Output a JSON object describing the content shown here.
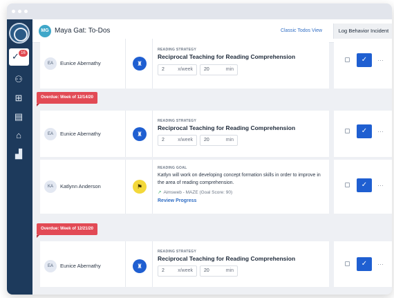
{
  "header": {
    "user_initials": "MG",
    "title": "Maya Gat: To-Dos",
    "classic_link": "Classic Todos View",
    "log_button": "Log Behavior Incident"
  },
  "sidebar": {
    "badge": "16",
    "items": [
      {
        "icon": "todo-icon"
      },
      {
        "icon": "student-group-icon"
      },
      {
        "icon": "classroom-icon"
      },
      {
        "icon": "clipboard-icon"
      },
      {
        "icon": "school-icon"
      },
      {
        "icon": "chart-icon"
      }
    ]
  },
  "overdue_labels": [
    "Overdue: Week of 12/14/20",
    "Overdue: Week of 12/21/20"
  ],
  "rows": [
    {
      "initials": "EA",
      "student": "Eunice Abernathy",
      "type_label": "READING STRATEGY",
      "title": "Reciprocal Teaching for Reading Comprehension",
      "freq": "2",
      "freq_unit": "x/week",
      "minutes": "20",
      "min_unit": "min"
    },
    {
      "initials": "EA",
      "student": "Eunice Abernathy",
      "type_label": "READING STRATEGY",
      "title": "Reciprocal Teaching for Reading Comprehension",
      "freq": "2",
      "freq_unit": "x/week",
      "minutes": "20",
      "min_unit": "min"
    },
    {
      "initials": "KA",
      "student": "Katlynn Anderson",
      "type_label": "READING GOAL",
      "goal_text": "Katlyn will work on developing concept formation skills in order to improve in the area of reading comprehension.",
      "measure": "Aimsweb - MAZE (Goal Score: 90)",
      "review": "Review Progress"
    },
    {
      "initials": "EA",
      "student": "Eunice Abernathy",
      "type_label": "READING STRATEGY",
      "title": "Reciprocal Teaching for Reading Comprehension",
      "freq": "2",
      "freq_unit": "x/week",
      "minutes": "20",
      "min_unit": "min"
    }
  ],
  "actions": {
    "check_glyph": "✓",
    "more_glyph": "···"
  },
  "colors": {
    "sidebar": "#1d3a5c",
    "accent": "#1f5fd1",
    "overdue": "#e24a55",
    "goal_icon": "#f3d83a"
  }
}
